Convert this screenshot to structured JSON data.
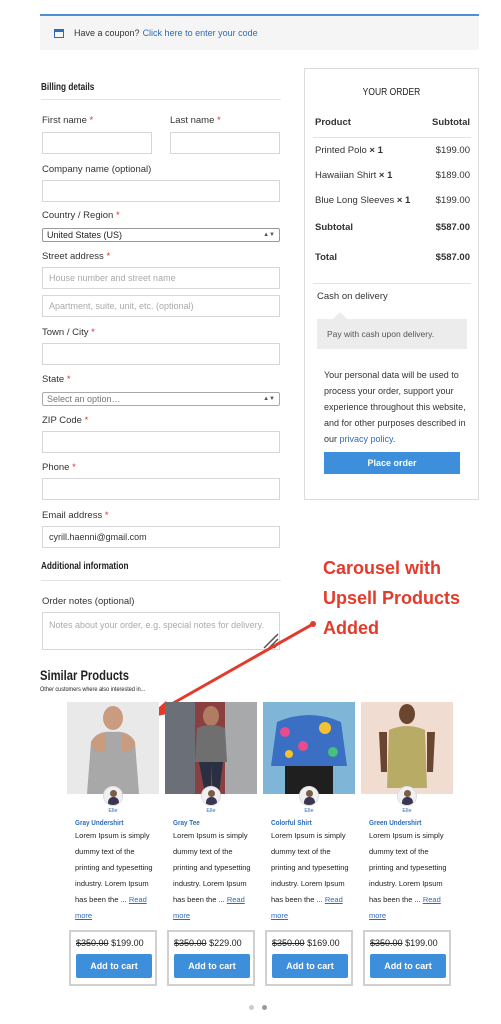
{
  "coupon": {
    "text": "Have a coupon?",
    "link": "Click here to enter your code"
  },
  "billing": {
    "heading": "Billing details",
    "first_name": "First name",
    "last_name": "Last name",
    "company": "Company name (optional)",
    "country_label": "Country / Region",
    "country_value": "United States (US)",
    "street_label": "Street address",
    "street_placeholder": "House number and street name",
    "apt_placeholder": "Apartment, suite, unit, etc. (optional)",
    "town": "Town / City",
    "state_label": "State",
    "state_value": "Select an option…",
    "zip": "ZIP Code",
    "phone": "Phone",
    "email_label": "Email address",
    "email_value": "cyrill.haenni@gmail.com",
    "required_mark": "*"
  },
  "additional": {
    "heading": "Additional information",
    "notes_label": "Order notes (optional)",
    "notes_placeholder": "Notes about your order, e.g. special notes for delivery."
  },
  "order": {
    "title": "YOUR ORDER",
    "col_product": "Product",
    "col_subtotal": "Subtotal",
    "items": [
      {
        "name": "Printed Polo",
        "qty": "× 1",
        "price": "$199.00"
      },
      {
        "name": "Hawaiian Shirt",
        "qty": "× 1",
        "price": "$189.00"
      },
      {
        "name": "Blue Long Sleeves",
        "qty": "× 1",
        "price": "$199.00"
      }
    ],
    "subtotal_label": "Subtotal",
    "subtotal_value": "$587.00",
    "total_label": "Total",
    "total_value": "$587.00",
    "payment_method": "Cash on delivery",
    "payment_desc": "Pay with cash upon delivery.",
    "privacy_text": "Your personal data will be used to process your order, support your experience throughout this website, and for other purposes described in our",
    "privacy_link": "privacy policy",
    "place_order": "Place order"
  },
  "annotation": {
    "text": "Carousel with Upsell Products Added",
    "color": "#e33b2b"
  },
  "similar": {
    "heading": "Similar Products",
    "subheading": "Other customers where also interested in...",
    "products": [
      {
        "author": "Elle",
        "name": "Gray Undershirt",
        "desc": "Lorem Ipsum is simply dummy text of the printing and typesetting industry. Lorem Ipsum has been the ...",
        "read_more": "Read more",
        "old_price": "$350.00",
        "price": "$199.00",
        "button": "Add to cart"
      },
      {
        "author": "Elle",
        "name": "Gray Tee",
        "desc": "Lorem Ipsum is simply dummy text of the printing and typesetting industry. Lorem Ipsum has been the ...",
        "read_more": "Read more",
        "old_price": "$350.00",
        "price": "$229.00",
        "button": "Add to cart"
      },
      {
        "author": "Elle",
        "name": "Colorful Shirt",
        "desc": "Lorem Ipsum is simply dummy text of the printing and typesetting industry. Lorem Ipsum has been the ...",
        "read_more": "Read more",
        "old_price": "$350.00",
        "price": "$169.00",
        "button": "Add to cart"
      },
      {
        "author": "Elle",
        "name": "Green Undershirt",
        "desc": "Lorem Ipsum is simply dummy text of the printing and typesetting industry. Lorem Ipsum has been the ...",
        "read_more": "Read more",
        "old_price": "$350.00",
        "price": "$199.00",
        "button": "Add to cart"
      }
    ]
  },
  "colors": {
    "accent": "#3d8edb",
    "link": "#2d6db5",
    "required": "#dd3333"
  }
}
